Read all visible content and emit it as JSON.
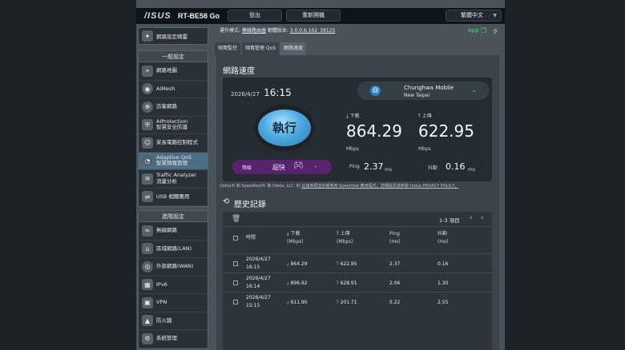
{
  "header": {
    "brand": "/ISUS",
    "model": "RT-BE58 Go",
    "logout": "登出",
    "reboot": "重新開機",
    "language": "繁體中文"
  },
  "sidebar": {
    "quick": "網路設定精靈",
    "general_title": "一般設定",
    "general": [
      {
        "label": "網路地圖",
        "icon": "map-icon"
      },
      {
        "label": "AiMesh",
        "icon": "mesh-icon"
      },
      {
        "label": "訪客網路",
        "icon": "guest-network-icon"
      },
      {
        "label": "AiProtection",
        "sub": "智慧安全防護",
        "icon": "shield-icon"
      },
      {
        "label": "家長電腦控制程式",
        "icon": "family-icon"
      },
      {
        "label": "Adaptive QoS",
        "sub": "智慧頻寬管理",
        "icon": "qos-icon"
      },
      {
        "label": "Traffic Analyzer",
        "sub": "流量分析",
        "icon": "traffic-icon"
      },
      {
        "label": "USB 相關應用",
        "icon": "usb-icon"
      }
    ],
    "advanced_title": "進階設定",
    "advanced": [
      {
        "label": "無線網路",
        "icon": "wifi-icon"
      },
      {
        "label": "區域網路(LAN)",
        "icon": "lan-icon"
      },
      {
        "label": "外部網路(WAN)",
        "icon": "wan-icon"
      },
      {
        "label": "IPv6",
        "icon": "ipv6-icon"
      },
      {
        "label": "VPN",
        "icon": "vpn-icon"
      },
      {
        "label": "防火牆",
        "icon": "firewall-icon"
      },
      {
        "label": "系統管理",
        "icon": "admin-icon"
      }
    ]
  },
  "status": {
    "op_mode_label": "運作模式:",
    "op_mode": "無線路由器",
    "firmware_label": "韌體版本:",
    "firmware": "3.0.0.6.102_39125",
    "app": "App"
  },
  "tabs": [
    "頻寬監控",
    "頻寬管理 QoS",
    "網路速度"
  ],
  "speed": {
    "title": "網路速度",
    "date": "2026/4/27",
    "time": "16:15",
    "go": "執行",
    "isp_name": "Chunghwa Mobile",
    "isp_city": "New Taipei",
    "download_label": "下載",
    "download": "864.29",
    "upload_label": "上傳",
    "upload": "622.95",
    "unit": "Mbps",
    "ping_label": "Ping",
    "ping": "2.37",
    "jitter_label": "抖動",
    "jitter": "0.16",
    "ms": "ms",
    "mode_label": "等級",
    "mode_value": "超快",
    "mode_trail": "–",
    "notice": "Ookla® 和 Speedtest® 為 Ookla, LLC. 的 ",
    "notice_tail": "註冊商標並授權使用 Speedtest 應用程式。詳細資訊請參閱 Ookla PRIVACY POLICY。"
  },
  "history": {
    "title": "歷史記錄",
    "pagination": "1-3 項目",
    "headers": {
      "time": "時間",
      "down": "下載",
      "down_unit": "(Mbps)",
      "up": "上傳",
      "up_unit": "(Mbps)",
      "ping": "Ping",
      "ping_unit": "(ms)",
      "jitter": "抖動",
      "jitter_unit": "(ms)"
    },
    "rows": [
      {
        "date": "2026/4/27",
        "time": "16:15",
        "down": "864.29",
        "up": "622.95",
        "ping": "2.37",
        "jitter": "0.16"
      },
      {
        "date": "2026/4/27",
        "time": "16:14",
        "down": "896.92",
        "up": "628.91",
        "ping": "2.06",
        "jitter": "1.30"
      },
      {
        "date": "2026/4/27",
        "time": "15:15",
        "down": "611.90",
        "up": "201.71",
        "ping": "5.22",
        "jitter": "2.55"
      }
    ]
  },
  "colors": {
    "accent": "#4fa9df",
    "mode": "#58236e",
    "active_nav": "#4c6d86"
  }
}
